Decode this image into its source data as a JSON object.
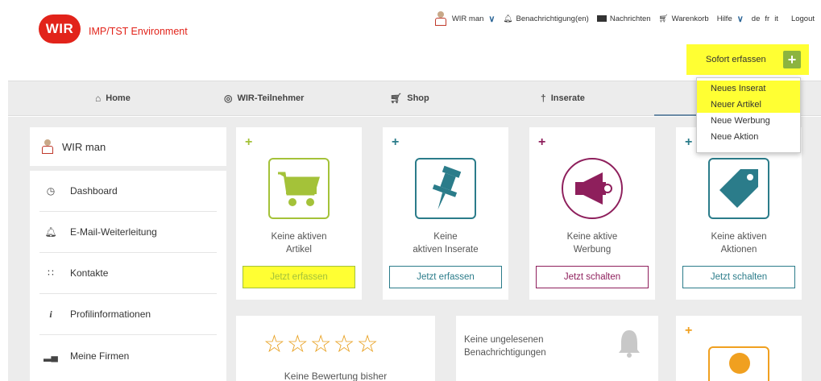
{
  "header": {
    "logo_text": "WIR",
    "environment": "IMP/TST Environment",
    "user_name": "WIR man",
    "notifications": "Benachrichtigung(en)",
    "messages": "Nachrichten",
    "cart": "Warenkorb",
    "help": "Hilfe",
    "languages": [
      "de",
      "fr",
      "it"
    ],
    "logout": "Logout",
    "sofort_label": "Sofort erfassen",
    "sofort_plus": "+"
  },
  "mainnav": {
    "items": [
      {
        "label": "Home",
        "icon": "home-icon"
      },
      {
        "label": "WIR-Teilnehmer",
        "icon": "map-marker-icon"
      },
      {
        "label": "Shop",
        "icon": "cart-icon"
      },
      {
        "label": "Inserate",
        "icon": "pin-icon"
      }
    ]
  },
  "dropdown": {
    "items": [
      "Neues Inserat",
      "Neuer Artikel",
      "Neue Werbung",
      "Neue Aktion"
    ],
    "highlighted": [
      "Neues Inserat",
      "Neuer Artikel"
    ]
  },
  "sidebar": {
    "user_name": "WIR man",
    "items": [
      {
        "label": "Dashboard",
        "icon": "clock-icon"
      },
      {
        "label": "E-Mail-Weiterleitung",
        "icon": "bell-icon"
      },
      {
        "label": "Kontakte",
        "icon": "contacts-icon"
      },
      {
        "label": "Profilinformationen",
        "icon": "info-icon"
      },
      {
        "label": "Meine Firmen",
        "icon": "chart-icon"
      }
    ]
  },
  "cards": [
    {
      "desc": "Keine aktiven\nArtikel",
      "button": "Jetzt erfassen",
      "color": "#a4c239",
      "icon": "shopping-cart-icon",
      "plus": "+"
    },
    {
      "desc": "Keine\naktiven Inserate",
      "button": "Jetzt erfassen",
      "color": "#2b7c8a",
      "icon": "pushpin-icon",
      "plus": "+"
    },
    {
      "desc": "Keine aktive\nWerbung",
      "button": "Jetzt schalten",
      "color": "#8e1f5c",
      "icon": "megaphone-icon",
      "plus": "+"
    },
    {
      "desc": "Keine aktiven\nAktionen",
      "button": "Jetzt schalten",
      "color": "#2b7c8a",
      "icon": "tag-icon",
      "plus": "+"
    }
  ],
  "rating": {
    "stars": "☆☆☆☆☆",
    "text": "Keine Bewertung bisher"
  },
  "notifications_box": {
    "text": "Keine ungelesenen Benachrichtigungen"
  },
  "profile_card": {
    "plus": "+",
    "color": "#f0a020"
  },
  "colors": {
    "brand_red": "#e2231a",
    "highlight_yellow": "#ffff33",
    "content_bg": "#ececec"
  }
}
